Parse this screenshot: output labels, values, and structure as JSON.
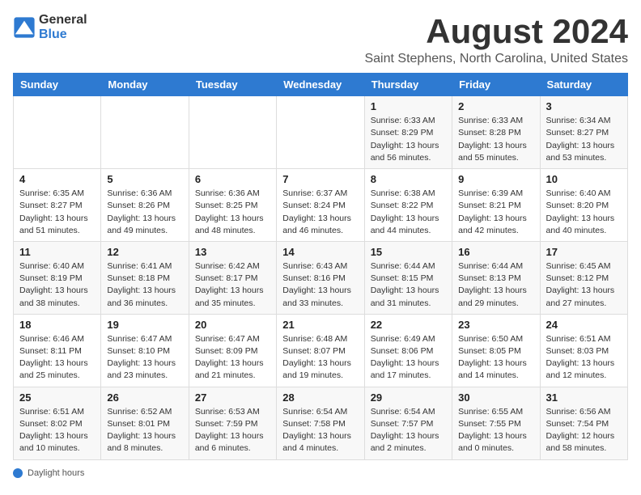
{
  "logo": {
    "general": "General",
    "blue": "Blue"
  },
  "title": "August 2024",
  "location": "Saint Stephens, North Carolina, United States",
  "days_of_week": [
    "Sunday",
    "Monday",
    "Tuesday",
    "Wednesday",
    "Thursday",
    "Friday",
    "Saturday"
  ],
  "weeks": [
    [
      {
        "day": "",
        "info": ""
      },
      {
        "day": "",
        "info": ""
      },
      {
        "day": "",
        "info": ""
      },
      {
        "day": "",
        "info": ""
      },
      {
        "day": "1",
        "info": "Sunrise: 6:33 AM\nSunset: 8:29 PM\nDaylight: 13 hours and 56 minutes."
      },
      {
        "day": "2",
        "info": "Sunrise: 6:33 AM\nSunset: 8:28 PM\nDaylight: 13 hours and 55 minutes."
      },
      {
        "day": "3",
        "info": "Sunrise: 6:34 AM\nSunset: 8:27 PM\nDaylight: 13 hours and 53 minutes."
      }
    ],
    [
      {
        "day": "4",
        "info": "Sunrise: 6:35 AM\nSunset: 8:27 PM\nDaylight: 13 hours and 51 minutes."
      },
      {
        "day": "5",
        "info": "Sunrise: 6:36 AM\nSunset: 8:26 PM\nDaylight: 13 hours and 49 minutes."
      },
      {
        "day": "6",
        "info": "Sunrise: 6:36 AM\nSunset: 8:25 PM\nDaylight: 13 hours and 48 minutes."
      },
      {
        "day": "7",
        "info": "Sunrise: 6:37 AM\nSunset: 8:24 PM\nDaylight: 13 hours and 46 minutes."
      },
      {
        "day": "8",
        "info": "Sunrise: 6:38 AM\nSunset: 8:22 PM\nDaylight: 13 hours and 44 minutes."
      },
      {
        "day": "9",
        "info": "Sunrise: 6:39 AM\nSunset: 8:21 PM\nDaylight: 13 hours and 42 minutes."
      },
      {
        "day": "10",
        "info": "Sunrise: 6:40 AM\nSunset: 8:20 PM\nDaylight: 13 hours and 40 minutes."
      }
    ],
    [
      {
        "day": "11",
        "info": "Sunrise: 6:40 AM\nSunset: 8:19 PM\nDaylight: 13 hours and 38 minutes."
      },
      {
        "day": "12",
        "info": "Sunrise: 6:41 AM\nSunset: 8:18 PM\nDaylight: 13 hours and 36 minutes."
      },
      {
        "day": "13",
        "info": "Sunrise: 6:42 AM\nSunset: 8:17 PM\nDaylight: 13 hours and 35 minutes."
      },
      {
        "day": "14",
        "info": "Sunrise: 6:43 AM\nSunset: 8:16 PM\nDaylight: 13 hours and 33 minutes."
      },
      {
        "day": "15",
        "info": "Sunrise: 6:44 AM\nSunset: 8:15 PM\nDaylight: 13 hours and 31 minutes."
      },
      {
        "day": "16",
        "info": "Sunrise: 6:44 AM\nSunset: 8:13 PM\nDaylight: 13 hours and 29 minutes."
      },
      {
        "day": "17",
        "info": "Sunrise: 6:45 AM\nSunset: 8:12 PM\nDaylight: 13 hours and 27 minutes."
      }
    ],
    [
      {
        "day": "18",
        "info": "Sunrise: 6:46 AM\nSunset: 8:11 PM\nDaylight: 13 hours and 25 minutes."
      },
      {
        "day": "19",
        "info": "Sunrise: 6:47 AM\nSunset: 8:10 PM\nDaylight: 13 hours and 23 minutes."
      },
      {
        "day": "20",
        "info": "Sunrise: 6:47 AM\nSunset: 8:09 PM\nDaylight: 13 hours and 21 minutes."
      },
      {
        "day": "21",
        "info": "Sunrise: 6:48 AM\nSunset: 8:07 PM\nDaylight: 13 hours and 19 minutes."
      },
      {
        "day": "22",
        "info": "Sunrise: 6:49 AM\nSunset: 8:06 PM\nDaylight: 13 hours and 17 minutes."
      },
      {
        "day": "23",
        "info": "Sunrise: 6:50 AM\nSunset: 8:05 PM\nDaylight: 13 hours and 14 minutes."
      },
      {
        "day": "24",
        "info": "Sunrise: 6:51 AM\nSunset: 8:03 PM\nDaylight: 13 hours and 12 minutes."
      }
    ],
    [
      {
        "day": "25",
        "info": "Sunrise: 6:51 AM\nSunset: 8:02 PM\nDaylight: 13 hours and 10 minutes."
      },
      {
        "day": "26",
        "info": "Sunrise: 6:52 AM\nSunset: 8:01 PM\nDaylight: 13 hours and 8 minutes."
      },
      {
        "day": "27",
        "info": "Sunrise: 6:53 AM\nSunset: 7:59 PM\nDaylight: 13 hours and 6 minutes."
      },
      {
        "day": "28",
        "info": "Sunrise: 6:54 AM\nSunset: 7:58 PM\nDaylight: 13 hours and 4 minutes."
      },
      {
        "day": "29",
        "info": "Sunrise: 6:54 AM\nSunset: 7:57 PM\nDaylight: 13 hours and 2 minutes."
      },
      {
        "day": "30",
        "info": "Sunrise: 6:55 AM\nSunset: 7:55 PM\nDaylight: 13 hours and 0 minutes."
      },
      {
        "day": "31",
        "info": "Sunrise: 6:56 AM\nSunset: 7:54 PM\nDaylight: 12 hours and 58 minutes."
      }
    ]
  ],
  "footer": {
    "label": "Daylight hours"
  }
}
